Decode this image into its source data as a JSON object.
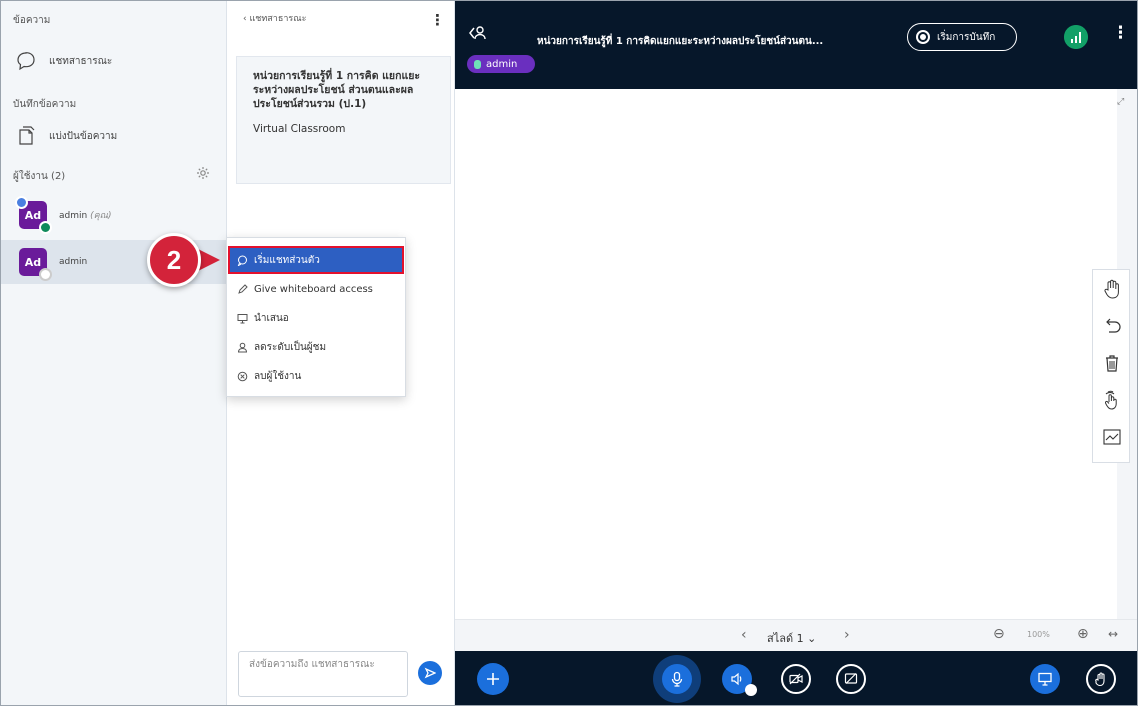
{
  "left_panel": {
    "messages_title": "ข้อความ",
    "public_chat_label": "แชทสาธารณะ",
    "notes_title": "บันทึกข้อความ",
    "shared_notes_label": "แบ่งปันข้อความ",
    "users_title": "ผู้ใช้งาน (2)",
    "users": [
      {
        "initials": "Ad",
        "name": "admin",
        "you_suffix": "(คุณ)"
      },
      {
        "initials": "Ad",
        "name": "admin",
        "you_suffix": ""
      }
    ]
  },
  "chat": {
    "header": "แชทสาธารณะ",
    "welcome_title": "หน่วยการเรียนรู้ที่ 1 การคิด แยกแยะระหว่างผลประโยชน์ ส่วนตนและผลประโยชน์ส่วนรวม (ป.1)",
    "welcome_subtitle": "Virtual Classroom",
    "input_placeholder": "ส่งข้อความถึง แชทสาธารณะ"
  },
  "context_menu": {
    "items": [
      {
        "label": "เริ่มแชทส่วนตัว",
        "icon": "chat-bubble-icon",
        "active": true
      },
      {
        "label": "Give whiteboard access",
        "icon": "pencil-icon",
        "active": false
      },
      {
        "label": "นำเสนอ",
        "icon": "presentation-icon",
        "active": false
      },
      {
        "label": "ลดระดับเป็นผู้ชม",
        "icon": "user-icon",
        "active": false
      },
      {
        "label": "ลบผู้ใช้งาน",
        "icon": "remove-circle-icon",
        "active": false
      }
    ]
  },
  "step_marker": "2",
  "topbar": {
    "title": "หน่วยการเรียนรู้ที่ 1 การคิดแยกแยะระหว่างผลประโยชน์ส่วนตน...",
    "record_label": "เริ่มการบันทึก",
    "talking_chip": "admin"
  },
  "slide_controls": {
    "slide_label": "สไลด์ 1",
    "zoom_label": "100%"
  },
  "colors": {
    "topbar_bg": "#06172a",
    "accent_blue": "#1b6fdc",
    "avatar_purple": "#6a1b9a",
    "highlight_red": "#e3112d",
    "menu_active": "#2d5fc2"
  }
}
